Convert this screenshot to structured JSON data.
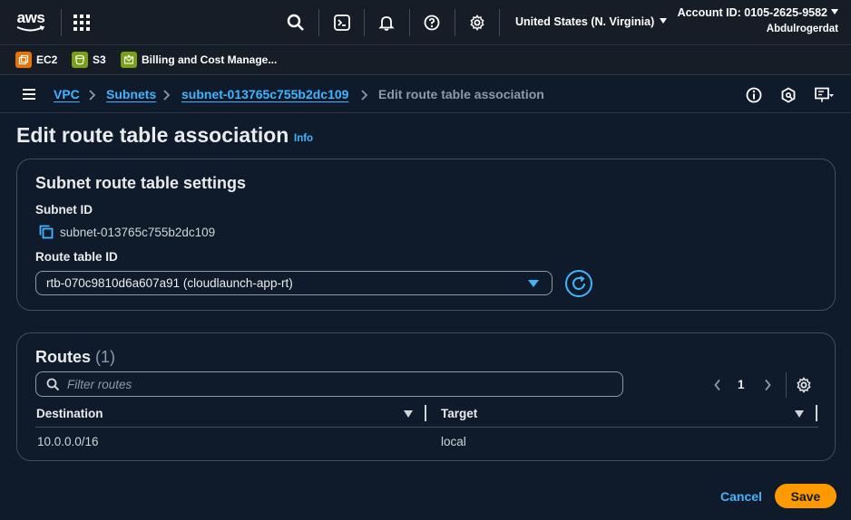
{
  "topnav": {
    "logo_text": "aws",
    "region": "United States (N. Virginia)",
    "account_id": "Account ID: 0105-2625-9582",
    "username": "Abdulrogerdat",
    "icons": [
      "grid-icon",
      "search-icon",
      "cloudshell-icon",
      "bell-icon",
      "help-icon",
      "gear-icon"
    ]
  },
  "favorites": [
    {
      "label": "EC2",
      "color": "#ed7100"
    },
    {
      "label": "S3",
      "color": "#7aa116"
    },
    {
      "label": "Billing and Cost Manage...",
      "color": "#7aa116"
    }
  ],
  "breadcrumb": {
    "items": [
      "VPC",
      "Subnets",
      "subnet-013765c755b2dc109"
    ],
    "current": "Edit route table association"
  },
  "page": {
    "title": "Edit route table association",
    "info_link": "Info"
  },
  "settings": {
    "title": "Subnet route table settings",
    "subnet_label": "Subnet ID",
    "subnet_value": "subnet-013765c755b2dc109",
    "route_table_label": "Route table ID",
    "route_table_value": "rtb-070c9810d6a607a91 (cloudlaunch-app-rt)"
  },
  "routes": {
    "title": "Routes",
    "count": "(1)",
    "filter_placeholder": "Filter routes",
    "page": "1",
    "columns": [
      "Destination",
      "Target"
    ],
    "rows": [
      [
        "10.0.0.0/16",
        "local"
      ]
    ]
  },
  "actions": {
    "cancel": "Cancel",
    "save": "Save"
  },
  "colors": {
    "accent": "#42b4ff",
    "primary_button": "#ff9900",
    "background": "#0f1b2a"
  }
}
